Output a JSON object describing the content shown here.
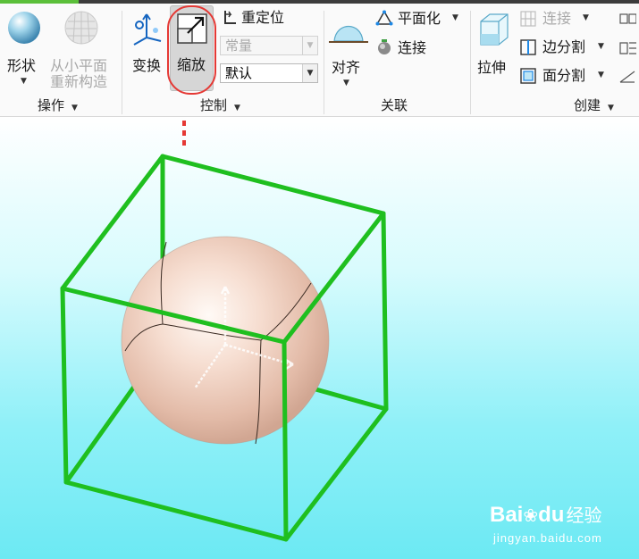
{
  "colors": {
    "ribbon_bg": "#fafafa",
    "accent_green": "#5bbf3a",
    "highlight_red": "#e53935",
    "cube_green": "#1fbf1f",
    "sphere_color": "#f3d9cc"
  },
  "groups": {
    "operations": {
      "label": "操作",
      "shape_label": "形状",
      "rebuild_label_line1": "从小平面",
      "rebuild_label_line2": "重新构造"
    },
    "control": {
      "label": "控制",
      "transform_label": "变换",
      "scale_label": "缩放",
      "reposition_label": "重定位",
      "constant_combo_value": "常量",
      "default_combo_value": "默认"
    },
    "associate": {
      "label": "关联",
      "align_label": "对齐",
      "planarize_label": "平面化",
      "connect_label": "连接"
    },
    "create": {
      "label": "创建",
      "extrude_label": "拉伸",
      "connect_label": "连接",
      "edge_split_label": "边分割",
      "face_split_label": "面分割"
    }
  },
  "icons": {
    "shape": "sphere-icon",
    "rebuild": "faceted-sphere-icon",
    "transform": "transform-axes-icon",
    "scale": "scale-arrow-icon",
    "reposition": "reposition-icon",
    "align": "align-dome-icon",
    "planarize": "planarize-icon",
    "connect": "connect-icon",
    "extrude": "extrude-cube-icon",
    "create_connect": "grid-connect-icon",
    "edge_split": "edge-split-icon",
    "face_split": "face-split-icon"
  },
  "watermark": {
    "brand_text": "Bai",
    "brand_suffix": "du",
    "experience_text": "经验",
    "url": "jingyan.baidu.com"
  }
}
